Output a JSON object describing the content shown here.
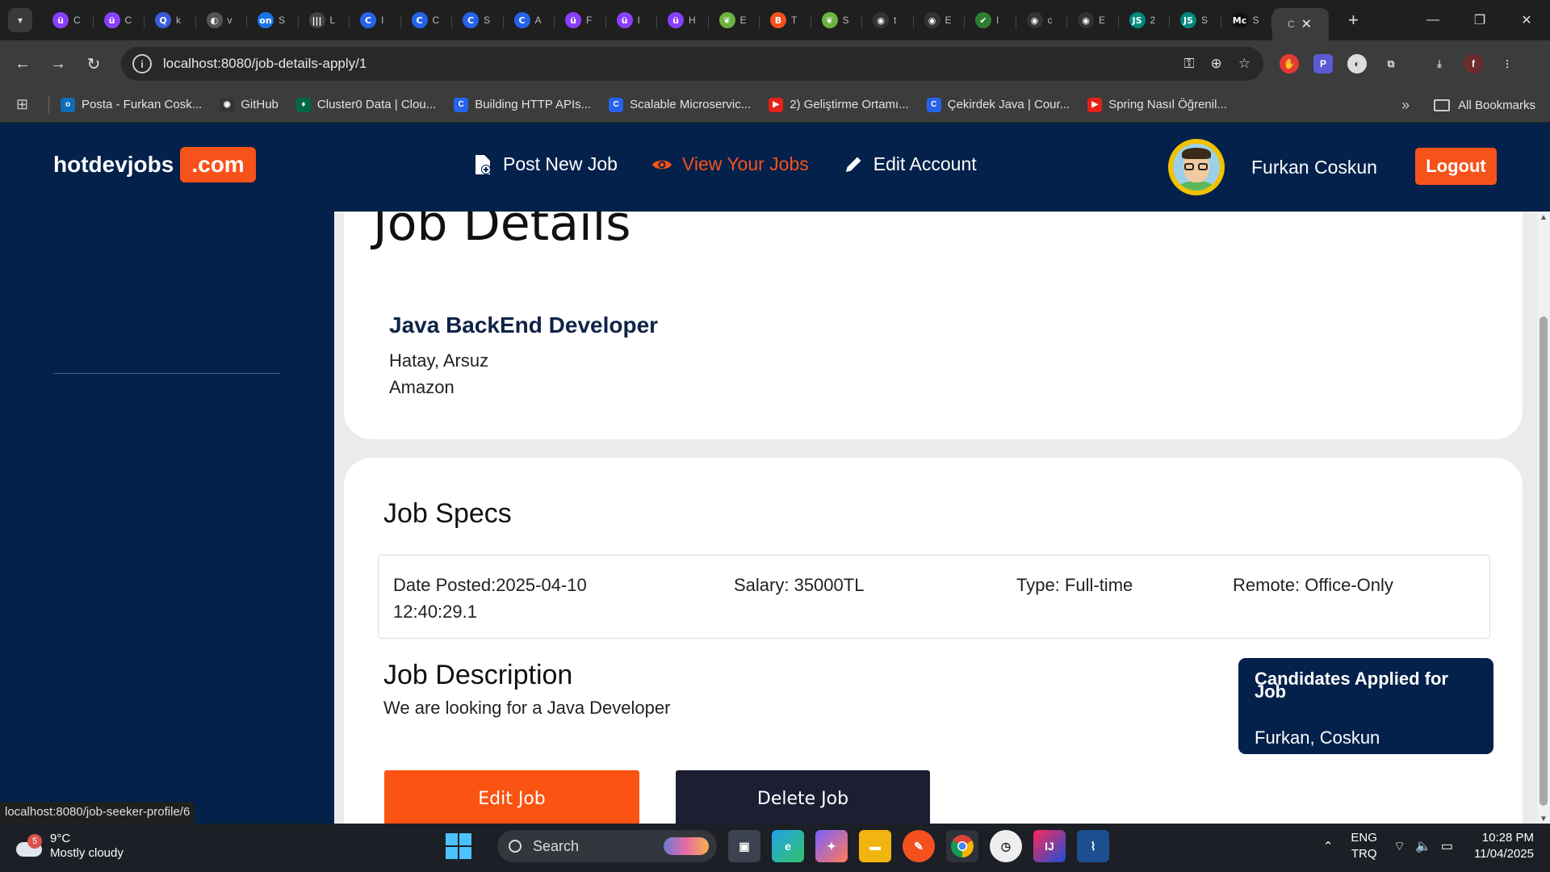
{
  "browser": {
    "tabs": [
      {
        "icon": "ü",
        "color": "#8a3ffc",
        "label": "C"
      },
      {
        "icon": "ü",
        "color": "#8a3ffc",
        "label": "C"
      },
      {
        "icon": "Q",
        "color": "#3b5bdb",
        "label": "k"
      },
      {
        "icon": "◐",
        "color": "#555555",
        "label": "v"
      },
      {
        "icon": "on",
        "color": "#1a73e8",
        "label": "S"
      },
      {
        "icon": "|||",
        "color": "#444444",
        "label": "L"
      },
      {
        "icon": "C",
        "color": "#2563eb",
        "label": "I"
      },
      {
        "icon": "C",
        "color": "#2563eb",
        "label": "C"
      },
      {
        "icon": "C",
        "color": "#2563eb",
        "label": "S"
      },
      {
        "icon": "C",
        "color": "#2563eb",
        "label": "A"
      },
      {
        "icon": "ü",
        "color": "#8a3ffc",
        "label": "F"
      },
      {
        "icon": "ü",
        "color": "#8a3ffc",
        "label": "I"
      },
      {
        "icon": "ü",
        "color": "#8a3ffc",
        "label": "H"
      },
      {
        "icon": "❦",
        "color": "#6db33f",
        "label": "E"
      },
      {
        "icon": "B",
        "color": "#f4511e",
        "label": "T"
      },
      {
        "icon": "❦",
        "color": "#6db33f",
        "label": "S"
      },
      {
        "icon": "◉",
        "color": "#333333",
        "label": "t"
      },
      {
        "icon": "◉",
        "color": "#333333",
        "label": "E"
      },
      {
        "icon": "✔",
        "color": "#2e7d32",
        "label": "I"
      },
      {
        "icon": "◉",
        "color": "#333333",
        "label": "c"
      },
      {
        "icon": "◉",
        "color": "#333333",
        "label": "E"
      },
      {
        "icon": "JS",
        "color": "#00897b",
        "label": "2"
      },
      {
        "icon": "JS",
        "color": "#00897b",
        "label": "S"
      },
      {
        "icon": "Mc",
        "color": "#111111",
        "label": "S"
      }
    ],
    "active_tab_label": "C",
    "url": "localhost:8080/job-details-apply/1",
    "bookmarks": [
      {
        "label": "Posta - Furkan Cosk...",
        "color": "#0f6cbd",
        "icon": "o"
      },
      {
        "label": "GitHub",
        "color": "#333333",
        "icon": "◉"
      },
      {
        "label": "Cluster0 Data | Clou...",
        "color": "#00684a",
        "icon": "♦"
      },
      {
        "label": "Building HTTP APIs...",
        "color": "#2563eb",
        "icon": "C"
      },
      {
        "label": "Scalable Microservic...",
        "color": "#2563eb",
        "icon": "C"
      },
      {
        "label": "2) Geliştirme Ortamı...",
        "color": "#e62117",
        "icon": "▶"
      },
      {
        "label": "Çekirdek Java | Cour...",
        "color": "#2563eb",
        "icon": "C"
      },
      {
        "label": "Spring Nasıl Öğrenil...",
        "color": "#e62117",
        "icon": "▶"
      }
    ],
    "all_bookmarks_label": "All Bookmarks",
    "status_url": "localhost:8080/job-seeker-profile/6"
  },
  "site": {
    "logo_main": "hotdevjobs",
    "logo_suffix": ".com",
    "nav": {
      "post": "Post New Job",
      "view": "View Your Jobs",
      "edit": "Edit Account"
    },
    "user_name": "Furkan Coskun",
    "logout_label": "Logout",
    "accent_color": "#f7521a",
    "navy_color": "#03214a"
  },
  "job": {
    "heading": "Job Details",
    "title": "Java BackEnd Developer",
    "location": "Hatay, Arsuz",
    "company": "Amazon",
    "specs_heading": "Job Specs",
    "date_posted_line1": "Date Posted:2025-04-10",
    "date_posted_line2": "12:40:29.1",
    "salary": "Salary: 35000TL",
    "type": "Type: Full-time",
    "remote": "Remote: Office-Only",
    "description_heading": "Job Description",
    "description": "We are looking for a Java Developer",
    "candidates_heading": "Candidates Applied for Job",
    "candidate_name": "Furkan, Coskun",
    "edit_label": "Edit Job",
    "delete_label": "Delete Job"
  },
  "taskbar": {
    "weather_temp": "9°C",
    "weather_desc": "Mostly cloudy",
    "weather_badge": "5",
    "search_label": "Search",
    "lang_line1": "ENG",
    "lang_line2": "TRQ",
    "time": "10:28 PM",
    "date": "11/04/2025"
  }
}
